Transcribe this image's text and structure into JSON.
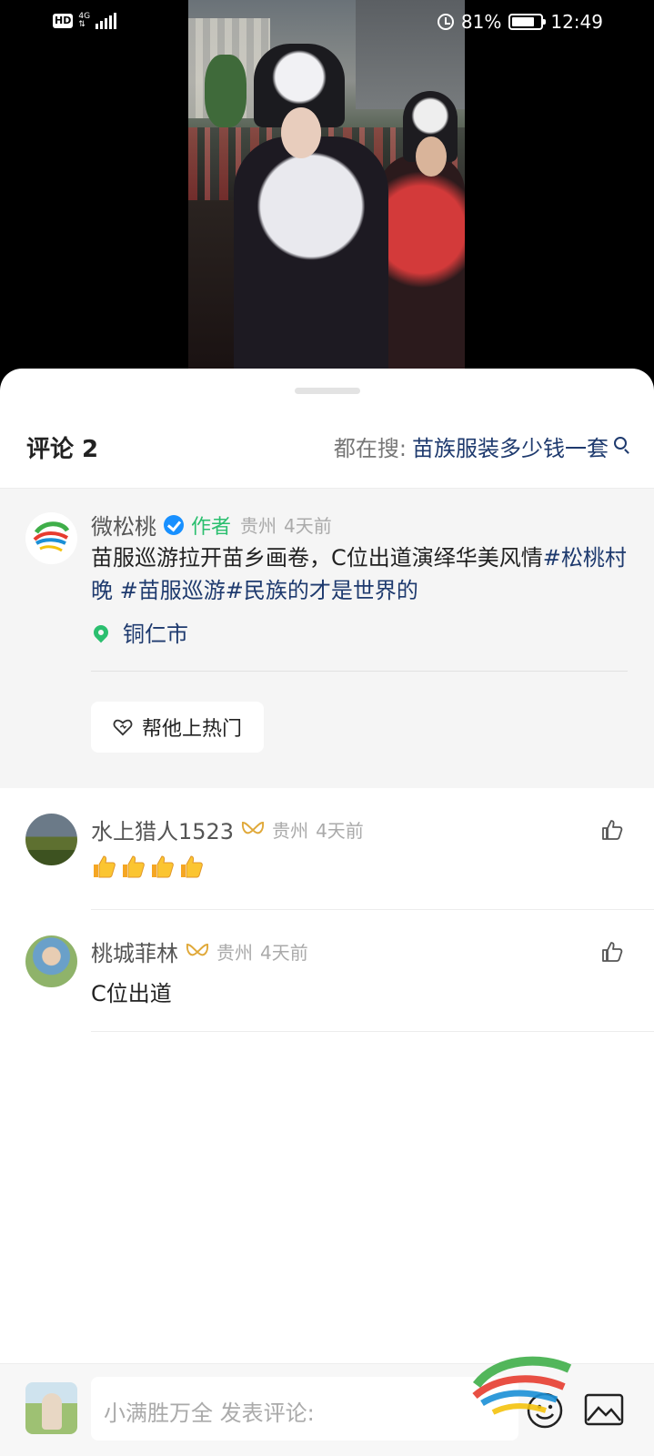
{
  "status_bar": {
    "hd": "HD",
    "network": "4G",
    "battery_percent": "81%",
    "battery_level": 0.81,
    "time": "12:49"
  },
  "video": {
    "icon": "video-thumbnail"
  },
  "comments_panel": {
    "count_label": "评论 2",
    "search_label": "都在搜:",
    "search_query": "苗族服装多少钱一套",
    "search_icon": "search-icon"
  },
  "author_post": {
    "name": "微松桃",
    "verified_icon": "verified-icon",
    "author_tag": "作者",
    "region": "贵州",
    "time": "4天前",
    "text_plain": "苗服巡游拉开苗乡画卷，C位出道演绎华美风情",
    "tag1": "#松桃村晚",
    "tag2": " #苗服巡游",
    "tag3": "#民族的才是世界的",
    "location": "铜仁市",
    "boost_label": "帮他上热门"
  },
  "comments": [
    {
      "name": "水上猎人1523",
      "region": "贵州",
      "time": "4天前",
      "body_emoji": "thumbs-up-emoji",
      "emoji_count": 4
    },
    {
      "name": "桃城菲林",
      "region": "贵州",
      "time": "4天前",
      "body": "C位出道"
    }
  ],
  "bottom_bar": {
    "placeholder": "小满胜万全 发表评论:",
    "emoji_icon": "emoji-icon",
    "image_icon": "image-icon"
  },
  "colors": {
    "accent_link": "#1e3a6e",
    "author_green": "#2bbf6f",
    "verified_blue": "#1890ff",
    "vip_gold": "#e0a93a"
  }
}
